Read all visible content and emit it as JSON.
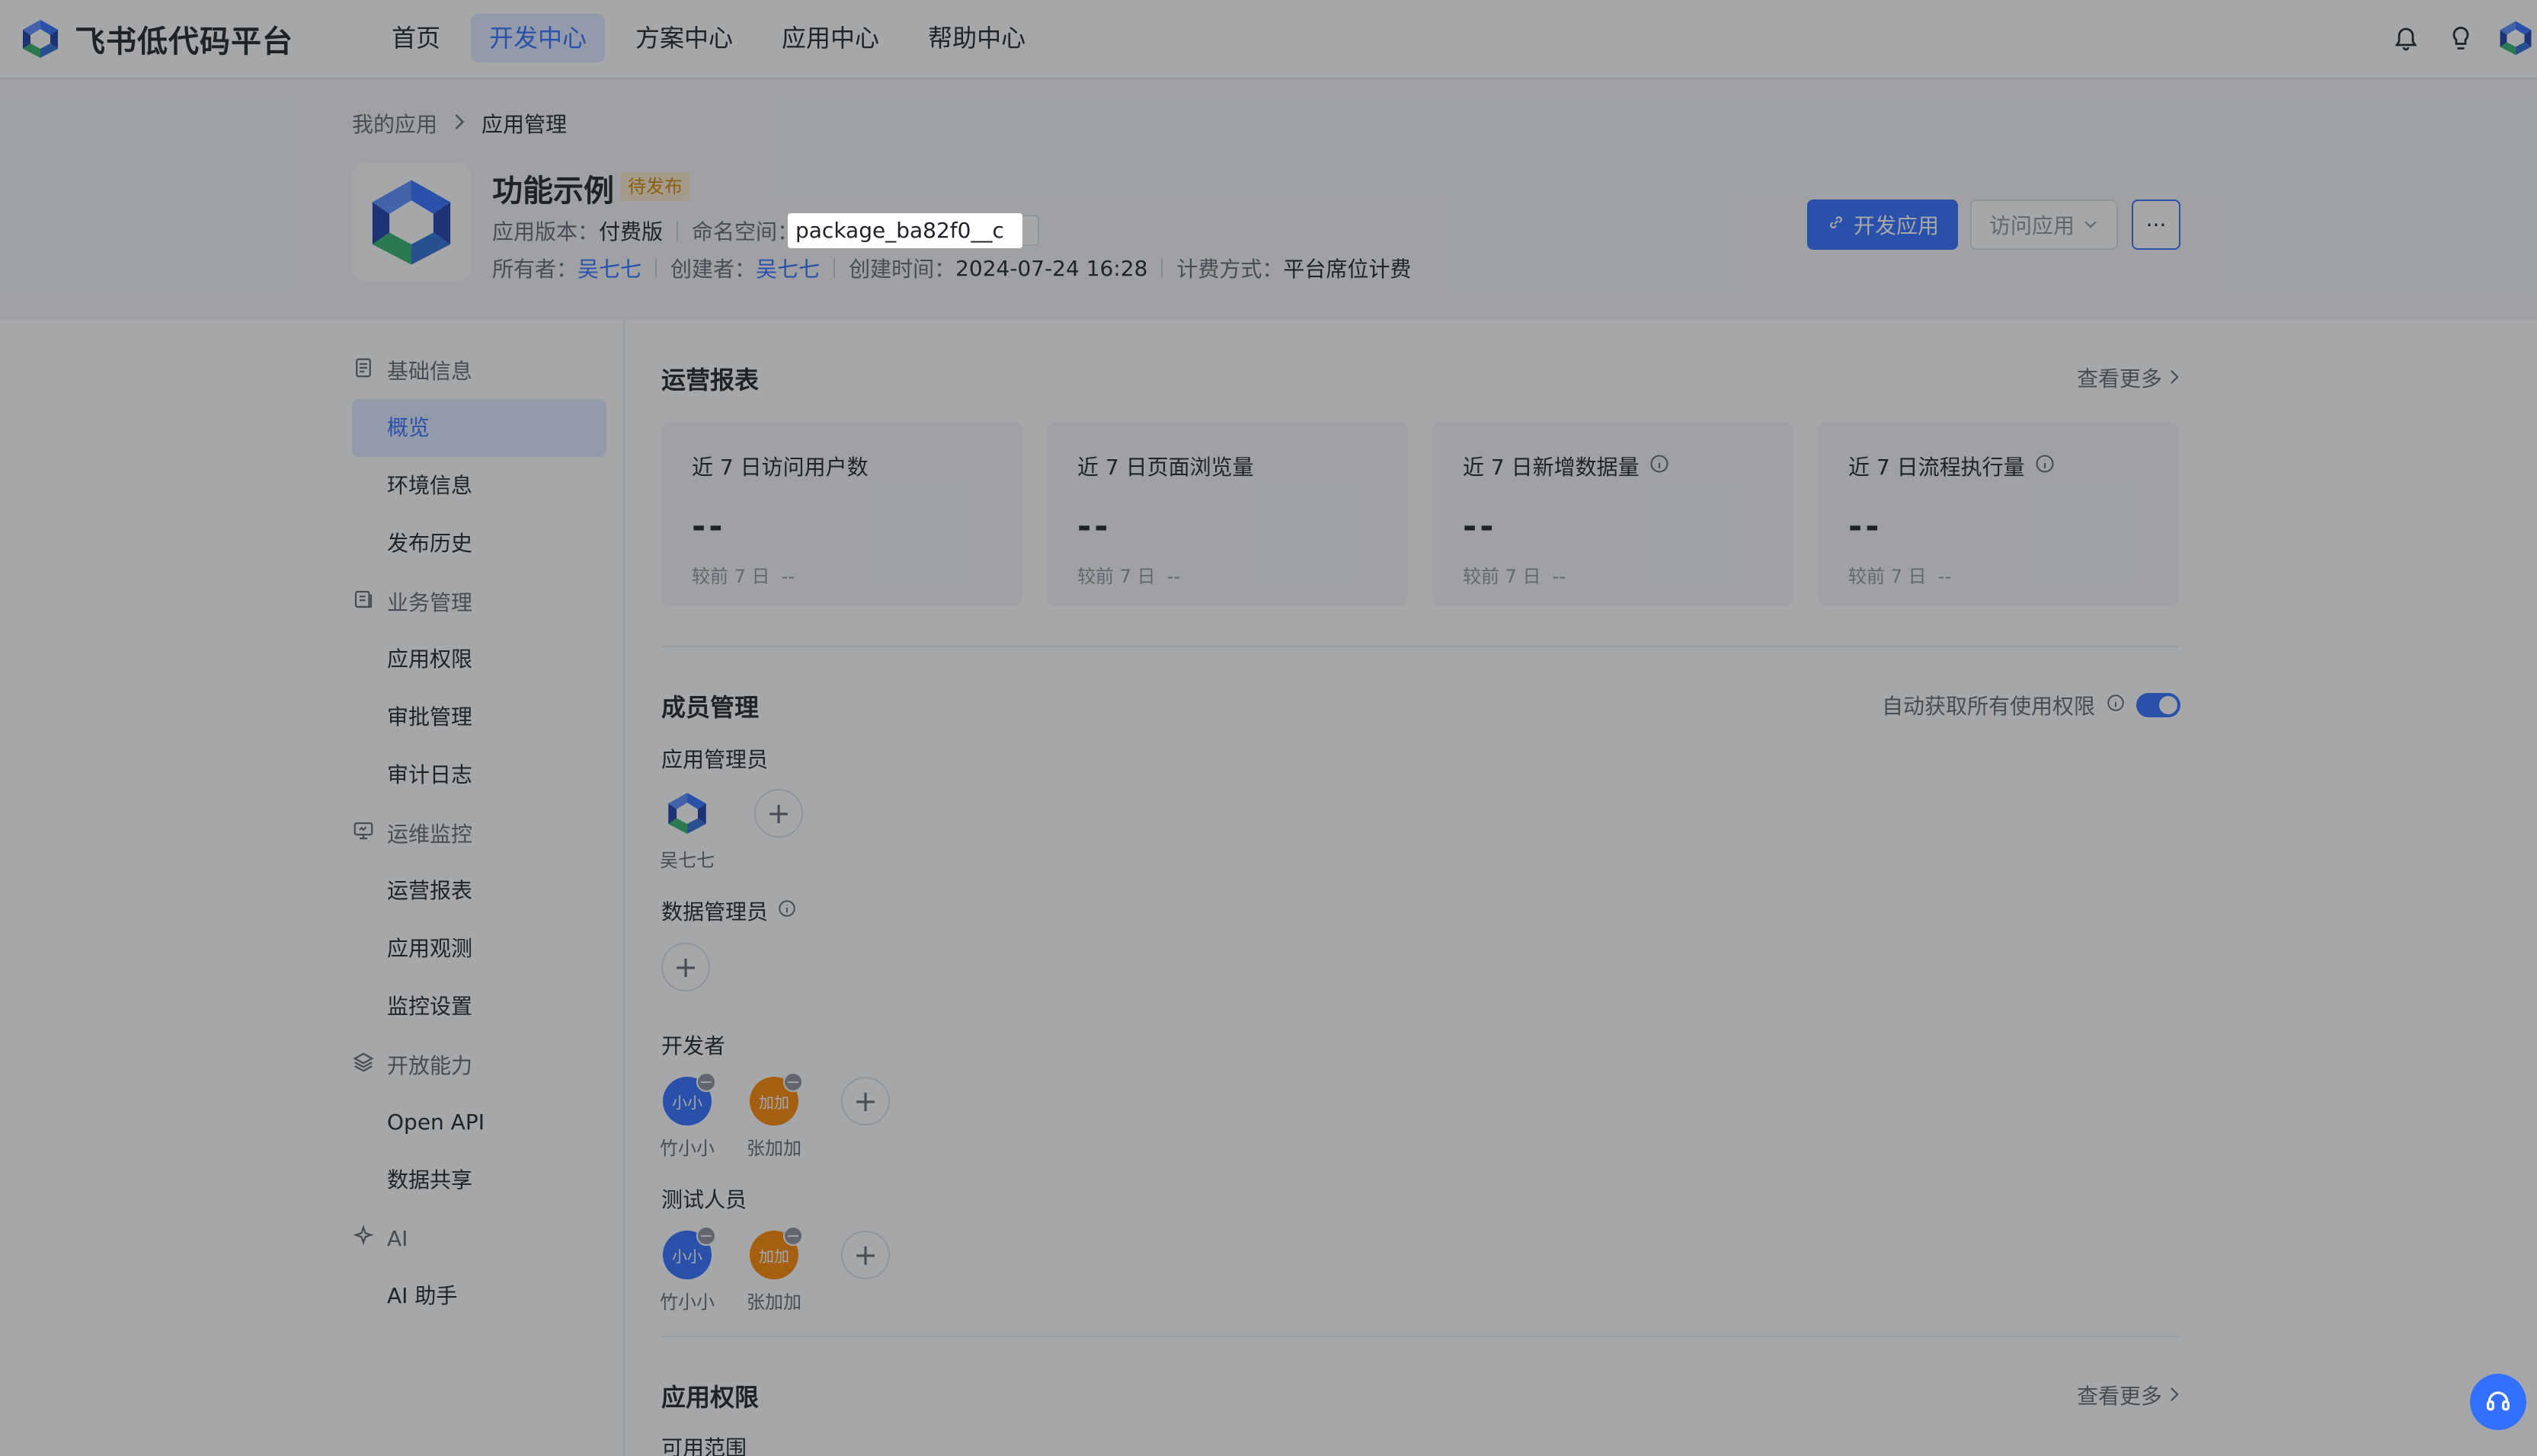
{
  "topbar": {
    "brand": "飞书低代码平台",
    "nav": [
      "首页",
      "开发中心",
      "方案中心",
      "应用中心",
      "帮助中心"
    ],
    "active_nav": 1
  },
  "breadcrumb": {
    "parent": "我的应用",
    "current": "应用管理"
  },
  "app": {
    "name": "功能示例",
    "status": "待发布",
    "version_label": "应用版本：",
    "version_value": "付费版",
    "namespace_label": "命名空间：",
    "namespace_value": "package_ba82f0__c",
    "owner_label": "所有者：",
    "owner_value": "吴七七",
    "creator_label": "创建者：",
    "creator_value": "吴七七",
    "created_label": "创建时间：",
    "created_value": "2024-07-24 16:28",
    "billing_label": "计费方式：",
    "billing_value": "平台席位计费"
  },
  "actions": {
    "develop": "开发应用",
    "visit": "访问应用",
    "more": "···"
  },
  "sidebar": {
    "groups": [
      {
        "label": "基础信息",
        "icon": "document-icon",
        "items": [
          "概览",
          "环境信息",
          "发布历史"
        ]
      },
      {
        "label": "业务管理",
        "icon": "briefcase-icon",
        "items": [
          "应用权限",
          "审批管理",
          "审计日志"
        ]
      },
      {
        "label": "运维监控",
        "icon": "monitor-icon",
        "items": [
          "运营报表",
          "应用观测",
          "监控设置"
        ]
      },
      {
        "label": "开放能力",
        "icon": "layers-icon",
        "items": [
          "Open API",
          "数据共享"
        ]
      },
      {
        "label": "AI",
        "icon": "sparkle-icon",
        "items": [
          "AI 助手"
        ]
      }
    ],
    "active_item": "概览"
  },
  "report": {
    "title": "运营报表",
    "see_more": "查看更多",
    "cards": [
      {
        "title": "近 7 日访问用户数",
        "value": "--",
        "compare": "较前 7 日",
        "compare_value": "--",
        "info": false
      },
      {
        "title": "近 7 日页面浏览量",
        "value": "--",
        "compare": "较前 7 日",
        "compare_value": "--",
        "info": false
      },
      {
        "title": "近 7 日新增数据量",
        "value": "--",
        "compare": "较前 7 日",
        "compare_value": "--",
        "info": true
      },
      {
        "title": "近 7 日流程执行量",
        "value": "--",
        "compare": "较前 7 日",
        "compare_value": "--",
        "info": true
      }
    ]
  },
  "members": {
    "title": "成员管理",
    "auto_perm": "自动获取所有使用权限",
    "app_admin_label": "应用管理员",
    "app_admin_name": "吴七七",
    "data_admin_label": "数据管理员",
    "dev_label": "开发者",
    "tester_label": "测试人员",
    "people": [
      {
        "name": "竹小小",
        "avatar_text": "小小",
        "color": "#3370ff"
      },
      {
        "name": "张加加",
        "avatar_text": "加加",
        "color": "#ff8800"
      }
    ]
  },
  "permissions": {
    "title": "应用权限",
    "see_more": "查看更多",
    "scope": "可用范围"
  }
}
